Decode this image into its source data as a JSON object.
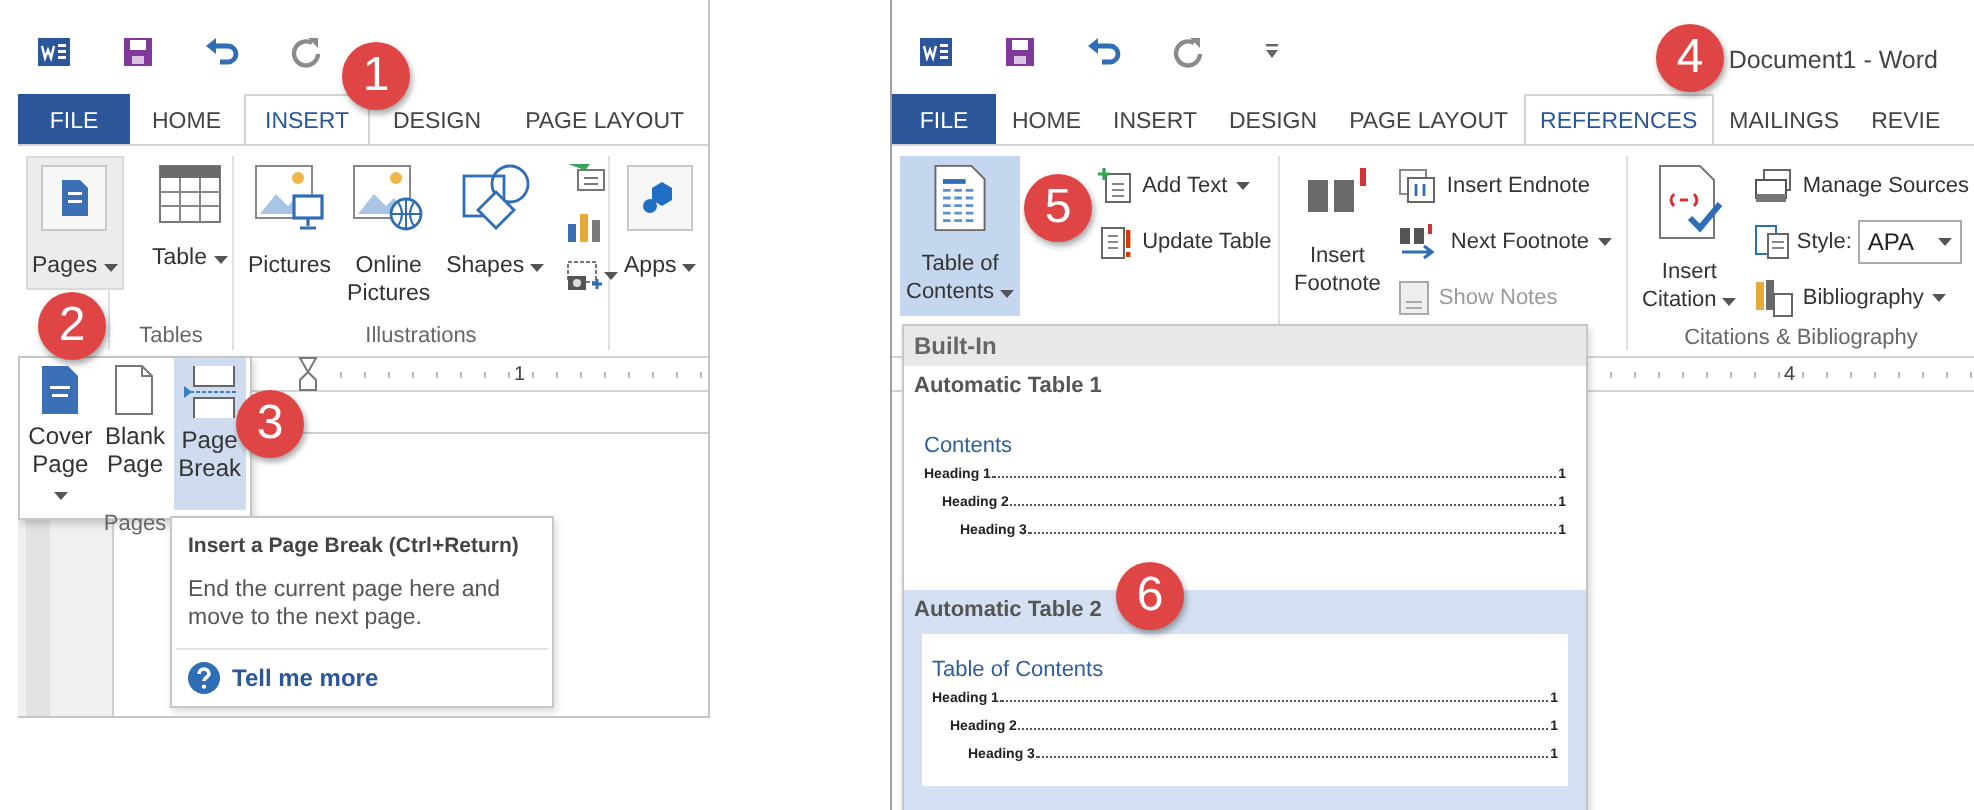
{
  "left_window": {
    "tabs": [
      {
        "label": "FILE",
        "kind": "file",
        "selected": false
      },
      {
        "label": "HOME",
        "kind": "tab",
        "selected": false
      },
      {
        "label": "INSERT",
        "kind": "tab",
        "selected": true
      },
      {
        "label": "DESIGN",
        "kind": "tab",
        "selected": false
      },
      {
        "label": "PAGE LAYOUT",
        "kind": "tab",
        "selected": false
      }
    ],
    "ribbon": [
      {
        "buttons": [
          {
            "label": "Pages",
            "kind": "large",
            "dropdown": true,
            "selected": true
          }
        ]
      },
      {
        "label": "Tables",
        "buttons": [
          {
            "label": "Table",
            "kind": "large",
            "dropdown": true,
            "selected": false
          }
        ]
      },
      {
        "label": "Illustrations",
        "buttons": [
          {
            "label": "Pictures",
            "kind": "large",
            "dropdown": false,
            "selected": false
          },
          {
            "label": "Online\nPictures",
            "kind": "large",
            "dropdown": false,
            "selected": false
          },
          {
            "label": "Shapes",
            "kind": "large",
            "dropdown": true,
            "selected": false
          },
          {
            "kind": "icons"
          }
        ]
      },
      {
        "buttons": [
          {
            "label": "Apps",
            "kind": "large",
            "dropdown": true,
            "selected": false
          }
        ]
      }
    ],
    "gallery": {
      "label": "Pages",
      "items": [
        {
          "label": "Cover\nPage",
          "dropdown": true,
          "selected": false
        },
        {
          "label": "Blank\nPage",
          "dropdown": false,
          "selected": false
        },
        {
          "label": "Page\nBreak",
          "dropdown": false,
          "selected": true
        }
      ]
    },
    "ruler": "1",
    "tooltip": {
      "title": "Insert a Page Break (Ctrl+Return)",
      "body": "End the current page here and move to the next page.",
      "link": "Tell me more"
    },
    "callouts": [
      "1",
      "2",
      "3"
    ]
  },
  "right_window": {
    "title": "Document1 - Word",
    "tabs": [
      {
        "label": "FILE",
        "kind": "file",
        "selected": false
      },
      {
        "label": "HOME",
        "kind": "tab",
        "selected": false
      },
      {
        "label": "INSERT",
        "kind": "tab",
        "selected": false
      },
      {
        "label": "DESIGN",
        "kind": "tab",
        "selected": false
      },
      {
        "label": "PAGE LAYOUT",
        "kind": "tab",
        "selected": false
      },
      {
        "label": "REFERENCES",
        "kind": "tab",
        "selected": true
      },
      {
        "label": "MAILINGS",
        "kind": "tab",
        "selected": false
      },
      {
        "label": "REVIE",
        "kind": "tab",
        "selected": false
      }
    ],
    "ribbon": [
      {
        "buttons": [
          {
            "label": "Table of\nContents",
            "kind": "large",
            "dropdown": true,
            "selected": true
          },
          {
            "label": "Add Text",
            "kind": "small",
            "dropdown": true,
            "disabled": false
          },
          {
            "label": "Update Table",
            "kind": "small",
            "dropdown": false,
            "disabled": false
          }
        ]
      },
      {
        "buttons": [
          {
            "label": "Insert\nFootnote",
            "kind": "large",
            "dropdown": false,
            "selected": false
          },
          {
            "label": "Insert Endnote",
            "kind": "small",
            "dropdown": false,
            "disabled": false
          },
          {
            "label": "Next Footnote",
            "kind": "small",
            "dropdown": true,
            "disabled": false
          },
          {
            "label": "Show Notes",
            "kind": "small",
            "dropdown": false,
            "disabled": true
          }
        ]
      },
      {
        "label": "Citations & Bibliography",
        "buttons": [
          {
            "label": "Insert\nCitation",
            "kind": "large",
            "dropdown": true,
            "selected": false
          },
          {
            "label": "Manage Sources",
            "kind": "small",
            "dropdown": false,
            "disabled": false
          },
          {
            "label": "Style:",
            "kind": "combo",
            "value": "APA"
          },
          {
            "label": "Bibliography",
            "kind": "small",
            "dropdown": true,
            "disabled": false
          }
        ]
      }
    ],
    "ruler": "4",
    "gallery": {
      "header": "Built-In",
      "items": [
        {
          "title": "Automatic Table 1",
          "heading": "Contents",
          "selected": false,
          "entries": [
            {
              "label": "Heading 1",
              "page": "1",
              "children": [
                {
                  "label": "Heading 2",
                  "page": "1",
                  "children": [
                    {
                      "label": "Heading 3",
                      "page": "1"
                    }
                  ]
                }
              ]
            }
          ]
        },
        {
          "title": "Automatic Table 2",
          "heading": "Table of Contents",
          "selected": true,
          "entries": [
            {
              "label": "Heading 1",
              "page": "1",
              "children": [
                {
                  "label": "Heading 2",
                  "page": "1",
                  "children": [
                    {
                      "label": "Heading 3",
                      "page": "1"
                    }
                  ]
                }
              ]
            }
          ]
        }
      ]
    },
    "callouts": [
      "4",
      "5",
      "6"
    ]
  }
}
